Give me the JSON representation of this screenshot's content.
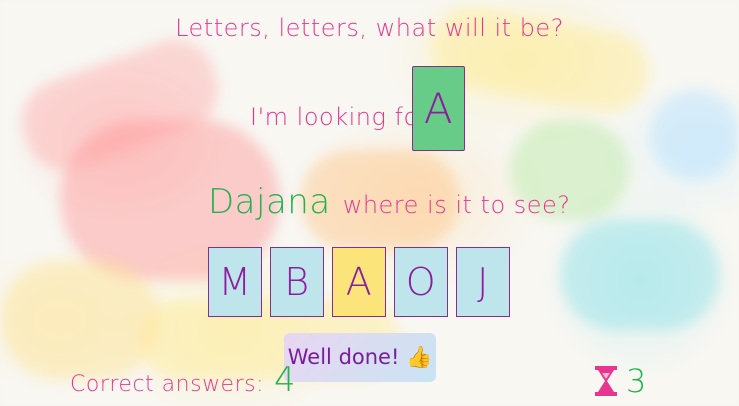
{
  "header": {
    "title": "Letters, letters, what will it be?"
  },
  "prompt": {
    "looking_for": "I'm looking for",
    "target_letter": "A"
  },
  "player": {
    "name": "Dajana",
    "question": "where is it to see?"
  },
  "choices": [
    {
      "letter": "M",
      "selected": false
    },
    {
      "letter": "B",
      "selected": false
    },
    {
      "letter": "A",
      "selected": true
    },
    {
      "letter": "O",
      "selected": false
    },
    {
      "letter": "J",
      "selected": false
    }
  ],
  "feedback": {
    "text": "Well done! 👍"
  },
  "score": {
    "label": "Correct answers:",
    "value": "4"
  },
  "timer": {
    "icon": "hourglass-icon",
    "value": "3"
  },
  "colors": {
    "pink": "#e8368f",
    "green": "#22b14c",
    "purple": "#8b1f9c",
    "target_card": "#66cc88",
    "choice_card": "#bfe5ec",
    "selected_card": "#fbe57a"
  }
}
